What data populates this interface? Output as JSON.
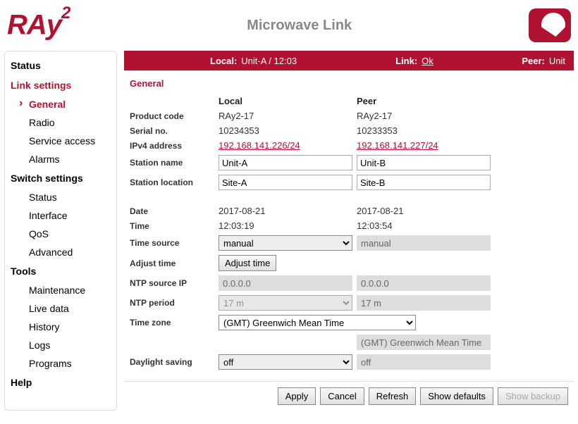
{
  "header": {
    "logo_main": "RAy",
    "logo_sup": "2",
    "title": "Microwave Link"
  },
  "topbar": {
    "local_label": "Local:",
    "local_value": "Unit-A / 12:03",
    "link_label": "Link:",
    "link_value": "Ok",
    "peer_label": "Peer:",
    "peer_value": "Unit"
  },
  "sidebar": {
    "status": "Status",
    "link_settings": "Link settings",
    "link_settings_items": {
      "general": "General",
      "radio": "Radio",
      "service_access": "Service access",
      "alarms": "Alarms"
    },
    "switch_settings": "Switch settings",
    "switch_items": {
      "status": "Status",
      "interface": "Interface",
      "qos": "QoS",
      "advanced": "Advanced"
    },
    "tools": "Tools",
    "tools_items": {
      "maintenance": "Maintenance",
      "live_data": "Live data",
      "history": "History",
      "logs": "Logs",
      "programs": "Programs"
    },
    "help": "Help"
  },
  "panel": {
    "title": "General",
    "col_local": "Local",
    "col_peer": "Peer",
    "rows": {
      "product_code": {
        "label": "Product code",
        "local": "RAy2-17",
        "peer": "RAy2-17"
      },
      "serial_no": {
        "label": "Serial no.",
        "local": "10234353",
        "peer": "10233353"
      },
      "ipv4": {
        "label": "IPv4 address",
        "local": "192.168.141.226/24",
        "peer": "192.168.141.227/24"
      },
      "station_name": {
        "label": "Station name",
        "local": "Unit-A",
        "peer": "Unit-B"
      },
      "station_loc": {
        "label": "Station location",
        "local": "Site-A",
        "peer": "Site-B"
      },
      "date": {
        "label": "Date",
        "local": "2017-08-21",
        "peer": "2017-08-21"
      },
      "time": {
        "label": "Time",
        "local": "12:03:19",
        "peer": "12:03:54"
      },
      "time_source": {
        "label": "Time source",
        "local": "manual",
        "peer": "manual"
      },
      "adjust_time": {
        "label": "Adjust time",
        "button": "Adjust time"
      },
      "ntp_ip": {
        "label": "NTP source IP",
        "local": "0.0.0.0",
        "peer": "0.0.0.0"
      },
      "ntp_period": {
        "label": "NTP period",
        "local": "17 m",
        "peer": "17 m"
      },
      "time_zone": {
        "label": "Time zone",
        "local": "(GMT) Greenwich Mean Time",
        "peer": "(GMT) Greenwich Mean Time"
      },
      "dst": {
        "label": "Daylight saving",
        "local": "off",
        "peer": "off"
      }
    }
  },
  "buttons": {
    "apply": "Apply",
    "cancel": "Cancel",
    "refresh": "Refresh",
    "show_defaults": "Show defaults",
    "show_backup": "Show backup"
  }
}
